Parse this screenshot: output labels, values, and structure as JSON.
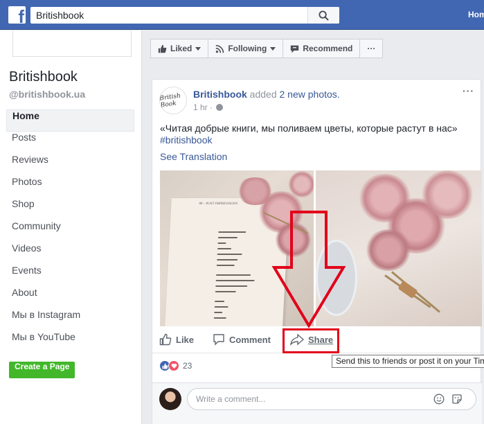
{
  "topbar": {
    "logo": "f",
    "search_value": "Britishbook",
    "home_label": "Home"
  },
  "sidebar": {
    "page_name": "Britishbook",
    "handle": "@britishbook.ua",
    "items": [
      {
        "label": "Home",
        "active": true
      },
      {
        "label": "Posts"
      },
      {
        "label": "Reviews"
      },
      {
        "label": "Photos"
      },
      {
        "label": "Shop"
      },
      {
        "label": "Community"
      },
      {
        "label": "Videos"
      },
      {
        "label": "Events"
      },
      {
        "label": "About"
      },
      {
        "label": "Мы в Instagram"
      },
      {
        "label": "Мы в YouTube"
      }
    ],
    "create_page_label": "Create a Page"
  },
  "actions": {
    "liked": "Liked",
    "following": "Following",
    "recommend": "Recommend",
    "more": "···"
  },
  "post": {
    "avatar_text": "British Book",
    "author": "Britishbook",
    "added": " added ",
    "photos": "2 new photos.",
    "time": "1 hr ·",
    "text": "«Читая добрые книги, мы поливаем цветы, которые растут в нас»",
    "hashtag": "#britishbook",
    "see_translation": "See Translation",
    "more": "···",
    "book_heading": "88 – POST IMPRESSIONS",
    "like_label": "Like",
    "comment_label": "Comment",
    "share_label": "Share",
    "share_tooltip": "Send this to friends or post it on your Tim",
    "reaction_count": "23",
    "comment_placeholder": "Write a comment..."
  },
  "colors": {
    "brand_blue": "#4267b2",
    "link_blue": "#385898",
    "green": "#42b72a",
    "highlight_red": "#e2001a",
    "love_pink": "#f25268"
  }
}
